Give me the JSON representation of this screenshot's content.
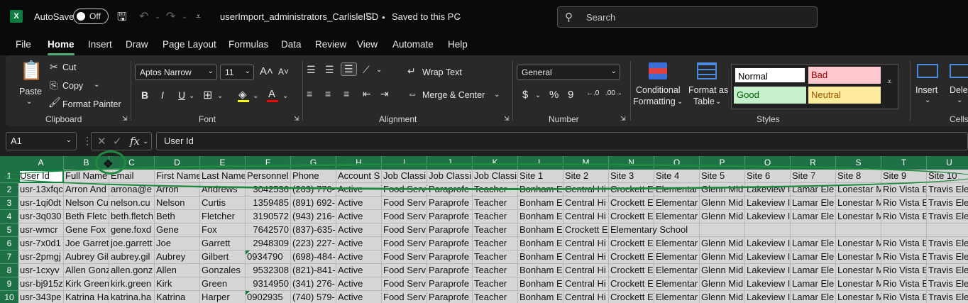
{
  "titlebar": {
    "logo": "X",
    "autosave_label": "AutoSave",
    "autosave_state": "Off",
    "doc_title": "userImport_administrators_CarlisleISD",
    "save_status": "Saved to this PC",
    "search_placeholder": "Search"
  },
  "menu": {
    "tabs": [
      "File",
      "Home",
      "Insert",
      "Draw",
      "Page Layout",
      "Formulas",
      "Data",
      "Review",
      "View",
      "Automate",
      "Help"
    ],
    "active": "Home"
  },
  "ribbon": {
    "clipboard": {
      "paste": "Paste",
      "cut": "Cut",
      "copy": "Copy",
      "format_painter": "Format Painter",
      "label": "Clipboard"
    },
    "font": {
      "family": "Aptos Narrow",
      "size": "11",
      "bold": "B",
      "italic": "I",
      "underline": "U",
      "label": "Font"
    },
    "alignment": {
      "wrap_text": "Wrap Text",
      "merge_center": "Merge & Center",
      "label": "Alignment"
    },
    "number": {
      "format": "General",
      "currency": "$",
      "percent": "%",
      "comma": "9",
      "label": "Number"
    },
    "styles": {
      "conditional_formatting": [
        "Conditional",
        "Formatting"
      ],
      "format_as_table": [
        "Format as",
        "Table"
      ],
      "normal": "Normal",
      "bad": "Bad",
      "good": "Good",
      "neutral": "Neutral",
      "label": "Styles",
      "colors": {
        "normal_bg": "#ffffff",
        "bad_bg": "#ffc7ce",
        "bad_fg": "#9c0006",
        "good_bg": "#c6efce",
        "good_fg": "#006100",
        "neutral_bg": "#ffeb9c",
        "neutral_fg": "#9c5700"
      }
    },
    "cells": {
      "insert": "Insert",
      "delete": "Delete",
      "label": "Cells"
    }
  },
  "formula_bar": {
    "name_box": "A1",
    "fx": "fx",
    "value": "User Id"
  },
  "sheet": {
    "columns": [
      "A",
      "B",
      "C",
      "D",
      "E",
      "F",
      "G",
      "H",
      "I",
      "J",
      "K",
      "L",
      "M",
      "N",
      "O",
      "P",
      "Q",
      "R",
      "S",
      "T",
      "U"
    ],
    "row_numbers": [
      "1",
      "2",
      "3",
      "4",
      "5",
      "6",
      "7",
      "8",
      "9",
      "10"
    ],
    "rows": [
      [
        "User Id",
        "Full Name",
        "Email",
        "First Name",
        "Last Name",
        "Personnel",
        "Phone",
        "Account S",
        "Job Classi",
        "Job Classi",
        "Job Classi",
        "Site 1",
        "Site 2",
        "Site 3",
        "Site 4",
        "Site 5",
        "Site 6",
        "Site 7",
        "Site 8",
        "Site 9",
        "Site 10"
      ],
      [
        "usr-13xfqc",
        "Arron And",
        "arrona@e",
        "Arron",
        "Andrews",
        "3042536",
        "(263) 776-",
        "Active",
        "Food Serv",
        "Paraprofe",
        "Teacher",
        "Bonham E",
        "Central Hi",
        "Crockett E",
        "Elementar",
        "Glenn Mid",
        "Lakeview I",
        "Lamar Ele",
        "Lonestar M",
        "Rio Vista E",
        "Travis Ele"
      ],
      [
        "usr-1qi0dt",
        "Nelson Cu",
        "nelson.cu",
        "Nelson",
        "Curtis",
        "1359485",
        "(891) 692-",
        "Active",
        "Food Serv",
        "Paraprofe",
        "Teacher",
        "Bonham E",
        "Central Hi",
        "Crockett E",
        "Elementar",
        "Glenn Mid",
        "Lakeview I",
        "Lamar Ele",
        "Lonestar M",
        "Rio Vista E",
        "Travis Ele"
      ],
      [
        "usr-3q030",
        "Beth Fletc",
        "beth.fletch",
        "Beth",
        "Fletcher",
        "3190572",
        "(943) 216-",
        "Active",
        "Food Serv",
        "Paraprofe",
        "Teacher",
        "Bonham E",
        "Central Hi",
        "Crockett E",
        "Elementar",
        "Glenn Mid",
        "Lakeview I",
        "Lamar Ele",
        "Lonestar M",
        "Rio Vista E",
        "Travis Ele"
      ],
      [
        "usr-wmcr",
        "Gene Fox",
        "gene.foxd",
        "Gene",
        "Fox",
        "7642570",
        "(837)-635-",
        "Active",
        "Food Serv",
        "Paraprofe",
        "Teacher",
        "Bonham E",
        "Crockett E",
        "Elementary School",
        "",
        "",
        "",
        "",
        "",
        "",
        ""
      ],
      [
        "usr-7x0d1",
        "Joe Garret",
        "joe.garrett",
        "Joe",
        "Garrett",
        "2948309",
        "(223) 227-",
        "Active",
        "Food Serv",
        "Paraprofe",
        "Teacher",
        "Bonham E",
        "Central Hi",
        "Crockett E",
        "Elementar",
        "Glenn Mid",
        "Lakeview I",
        "Lamar Ele",
        "Lonestar M",
        "Rio Vista E",
        "Travis Ele"
      ],
      [
        "usr-2pmgj",
        "Aubrey Gil",
        "aubrey.gil",
        "Aubrey",
        "Gilbert",
        "0934790",
        "(698)-484-",
        "Active",
        "Food Serv",
        "Paraprofe",
        "Teacher",
        "Bonham E",
        "Central Hi",
        "Crockett E",
        "Elementar",
        "Glenn Mid",
        "Lakeview I",
        "Lamar Ele",
        "Lonestar M",
        "Rio Vista E",
        "Travis Ele"
      ],
      [
        "usr-1cxyv",
        "Allen Gonz",
        "allen.gonz",
        "Allen",
        "Gonzales",
        "9532308",
        "(821)-841-",
        "Active",
        "Food Serv",
        "Paraprofe",
        "Teacher",
        "Bonham E",
        "Central Hi",
        "Crockett E",
        "Elementar",
        "Glenn Mid",
        "Lakeview I",
        "Lamar Ele",
        "Lonestar M",
        "Rio Vista E",
        "Travis Ele"
      ],
      [
        "usr-bj915z",
        "Kirk Green",
        "kirk.green",
        "Kirk",
        "Green",
        "9314950",
        "(341) 276-",
        "Active",
        "Food Serv",
        "Paraprofe",
        "Teacher",
        "Bonham E",
        "Central Hi",
        "Crockett E",
        "Elementar",
        "Glenn Mid",
        "Lakeview I",
        "Lamar Ele",
        "Lonestar M",
        "Rio Vista E",
        "Travis Ele"
      ],
      [
        "usr-343pe",
        "Katrina Ha",
        "katrina.ha",
        "Katrina",
        "Harper",
        "0902935",
        "(740) 579-",
        "Active",
        "Food Serv",
        "Paraprofe",
        "Teacher",
        "Bonham E",
        "Central Hi",
        "Crockett E",
        "Elementar",
        "Glenn Mid",
        "Lakeview I",
        "Lamar Ele",
        "Lonestar M",
        "Rio Vista E",
        "Travis Ele"
      ]
    ]
  }
}
